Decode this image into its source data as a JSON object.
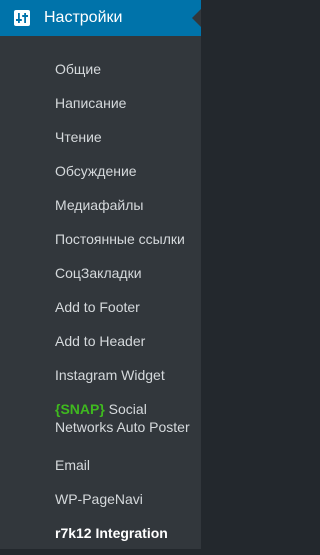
{
  "header": {
    "title": "Настройки",
    "icon": "settings-sliders-icon"
  },
  "submenu": [
    {
      "label": "Общие"
    },
    {
      "label": "Написание"
    },
    {
      "label": "Чтение"
    },
    {
      "label": "Обсуждение"
    },
    {
      "label": "Медиафайлы"
    },
    {
      "label": "Постоянные ссылки"
    },
    {
      "label": "СоцЗакладки"
    },
    {
      "label": "Add to Footer"
    },
    {
      "label": "Add to Header"
    },
    {
      "label": "Instagram Widget"
    },
    {
      "label_prefix": "{SNAP}",
      "label": " Social Networks Auto Poster"
    },
    {
      "label": "Email"
    },
    {
      "label": "WP-PageNavi"
    },
    {
      "label": "r7k12 Integration"
    }
  ],
  "colors": {
    "header_bg": "#0073aa",
    "menu_bg": "#32373c",
    "text": "#d5d9dc",
    "snap_green": "#3fb91f"
  }
}
